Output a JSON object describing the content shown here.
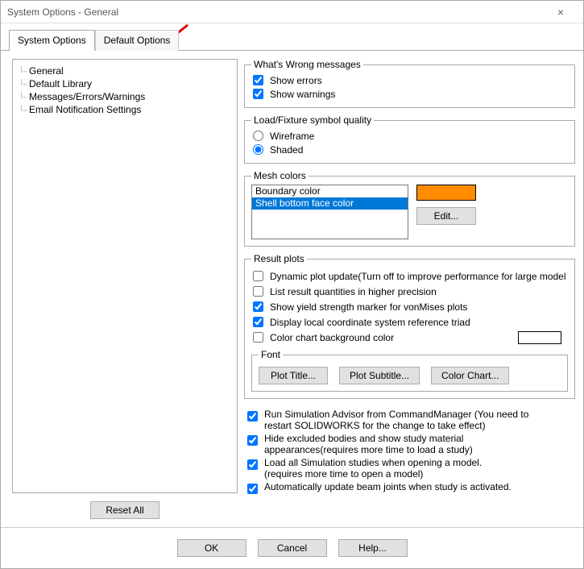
{
  "window": {
    "title": "System Options - General"
  },
  "tabs": {
    "system": "System Options",
    "default": "Default Options"
  },
  "tree": {
    "items": [
      "General",
      "Default Library",
      "Messages/Errors/Warnings",
      "Email Notification Settings"
    ]
  },
  "whats_wrong": {
    "legend": "What's Wrong messages",
    "show_errors": "Show errors",
    "show_warnings": "Show warnings"
  },
  "load_fixture": {
    "legend": "Load/Fixture symbol quality",
    "wireframe": "Wireframe",
    "shaded": "Shaded"
  },
  "mesh": {
    "legend": "Mesh colors",
    "items": [
      "Boundary color",
      "Shell bottom face color"
    ],
    "edit": "Edit...",
    "swatch_color": "#ff8c00"
  },
  "result_plots": {
    "legend": "Result plots",
    "dynamic": "Dynamic plot update(Turn off to improve performance for large model",
    "list_precision": "List result quantities in higher precision",
    "yield": "Show yield strength marker for vonMises plots",
    "triad": "Display local coordinate system reference triad",
    "bgcolor": "Color chart background color",
    "font_legend": "Font",
    "plot_title": "Plot Title...",
    "plot_subtitle": "Plot Subtitle...",
    "color_chart": "Color Chart..."
  },
  "misc": {
    "run_advisor": "Run Simulation Advisor from CommandManager (You need to restart SOLIDWORKS for the change to take effect)",
    "hide_excluded": "Hide excluded bodies and show study material appearances(requires more time to load a study)",
    "load_all": "Load all Simulation studies when opening a model.\n(requires more time to open a model)",
    "auto_beam": "Automatically update beam joints when study is activated."
  },
  "buttons": {
    "reset_all": "Reset All",
    "ok": "OK",
    "cancel": "Cancel",
    "help": "Help..."
  }
}
